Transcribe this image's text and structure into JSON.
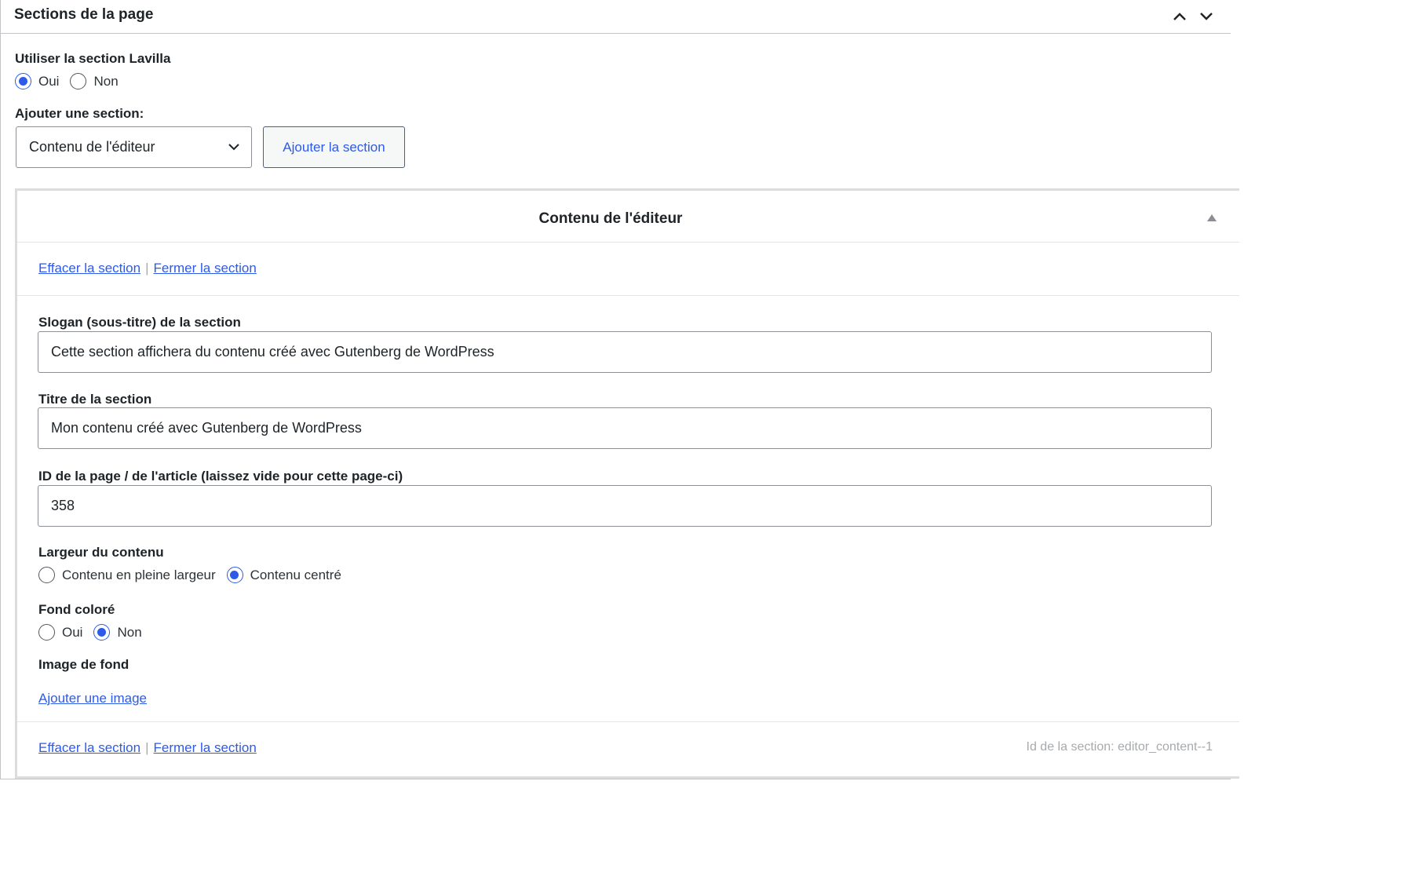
{
  "metabox": {
    "title": "Sections de la page",
    "controls": [
      "move-up-icon",
      "move-down-icon"
    ]
  },
  "use_section": {
    "label": "Utiliser la section Lavilla",
    "options": [
      "Oui",
      "Non"
    ],
    "selected": "Oui"
  },
  "add_section": {
    "label": "Ajouter une section:",
    "select_value": "Contenu de l'éditeur",
    "button_label": "Ajouter la section"
  },
  "section": {
    "title": "Contenu de l'éditeur",
    "clear_link": "Effacer la section",
    "separator": "|",
    "close_link": "Fermer la section",
    "fields": {
      "slogan_label": "Slogan (sous-titre) de la section",
      "slogan_value": "Cette section affichera du contenu créé avec Gutenberg de WordPress",
      "title_label": "Titre de la section",
      "title_value": "Mon contenu créé avec Gutenberg de WordPress",
      "id_label": "ID de la page / de l'article (laissez vide pour cette page-ci)",
      "id_value": "358"
    },
    "width": {
      "label": "Largeur du contenu",
      "options": [
        "Contenu en pleine largeur",
        "Contenu centré"
      ],
      "selected": "Contenu centré"
    },
    "colored_bg": {
      "label": "Fond coloré",
      "options": [
        "Oui",
        "Non"
      ],
      "selected": "Non"
    },
    "bg_image": {
      "label": "Image de fond",
      "add_link": "Ajouter une image"
    },
    "section_id": "Id de la section: editor_content--1"
  },
  "colors": {
    "accent": "#2d5ae8",
    "border": "#8c8f94",
    "muted_text": "#a7aaad"
  }
}
